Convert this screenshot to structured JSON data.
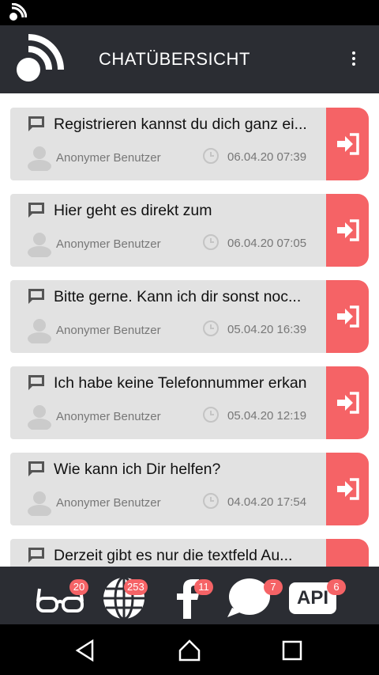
{
  "header": {
    "title": "CHATÜBERSICHT"
  },
  "chats": [
    {
      "message": "Registrieren kannst du dich ganz ei...",
      "user": "Anonymer Benutzer",
      "time": "06.04.20 07:39"
    },
    {
      "message": "Hier geht es direkt zum",
      "user": "Anonymer Benutzer",
      "time": "06.04.20 07:05"
    },
    {
      "message": "Bitte gerne. Kann ich dir sonst noc...",
      "user": "Anonymer Benutzer",
      "time": "05.04.20 16:39"
    },
    {
      "message": "Ich habe keine Telefonnummer erkan",
      "user": "Anonymer Benutzer",
      "time": "05.04.20 12:19"
    },
    {
      "message": "Wie kann ich Dir helfen?",
      "user": "Anonymer Benutzer",
      "time": "04.04.20 17:54"
    },
    {
      "message": "Derzeit gibt es nur die textfeld Au...",
      "user": "",
      "time": ""
    }
  ],
  "tabs": [
    {
      "icon": "glasses-icon",
      "badge": "20"
    },
    {
      "icon": "globe-icon",
      "badge": "253"
    },
    {
      "icon": "facebook-icon",
      "badge": "11"
    },
    {
      "icon": "chat-bubble-icon",
      "badge": "7"
    },
    {
      "icon": "api-icon",
      "label": "API",
      "badge": "6"
    }
  ],
  "colors": {
    "accent": "#f56366",
    "bar": "#2b2d33",
    "card": "#e2e2e2"
  }
}
